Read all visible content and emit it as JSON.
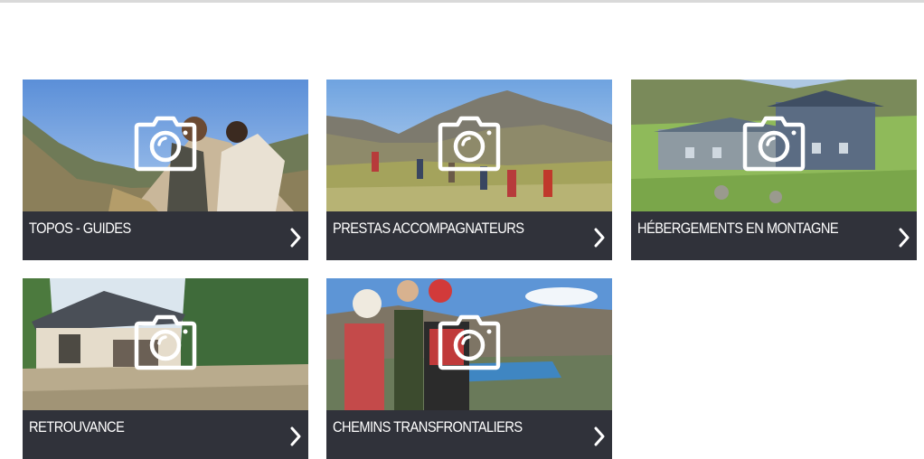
{
  "cards": [
    {
      "label": "TOPOS - GUIDES",
      "icon": "camera-icon"
    },
    {
      "label": "PRESTAS ACCOMPAGNATEURS",
      "icon": "camera-icon"
    },
    {
      "label": "HÉBERGEMENTS EN MONTAGNE",
      "icon": "camera-icon"
    },
    {
      "label": "RETROUVANCE",
      "icon": "camera-icon"
    },
    {
      "label": "CHEMINS TRANSFRONTALIERS",
      "icon": "camera-icon"
    }
  ],
  "colors": {
    "caption_bg": "#30323a",
    "caption_text": "#ffffff",
    "top_rule": "#d9d9d9"
  }
}
